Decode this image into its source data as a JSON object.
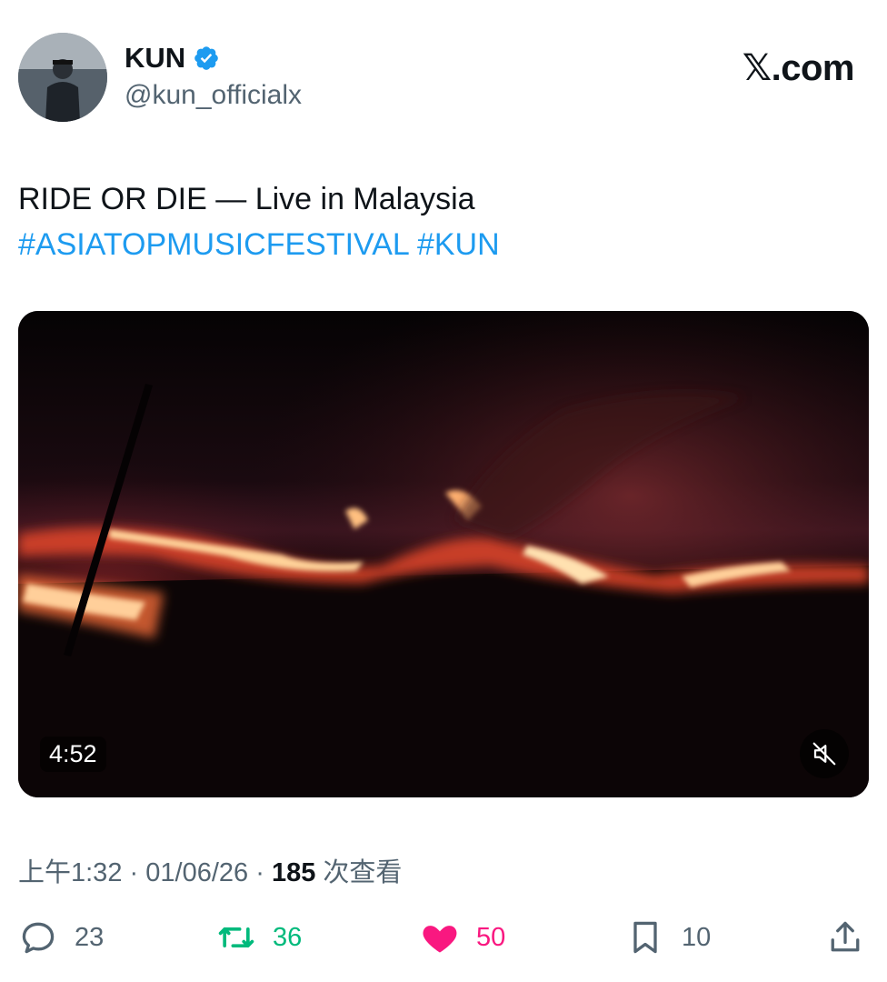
{
  "author": {
    "display_name": "KUN",
    "handle": "@kun_officialx",
    "verified": true,
    "avatar_icon": "profile-photo"
  },
  "brand": {
    "label": "𝕏.com"
  },
  "tweet": {
    "text_line": "RIDE OR DIE — Live in Malaysia",
    "hashtags": [
      "#ASIATOPMUSICFESTIVAL",
      "#KUN"
    ]
  },
  "media": {
    "duration": "4:52",
    "mute_icon": "muted-speaker-icon"
  },
  "meta": {
    "time": "上午1:32",
    "separator": "·",
    "date": "01/06/26",
    "views_count": "185",
    "views_label": "次查看"
  },
  "actions": {
    "replies": "23",
    "retweets": "36",
    "likes": "50",
    "bookmarks": "10"
  },
  "colors": {
    "hashtag": "#1d9bf0",
    "verified": "#1d9bf0",
    "retweet": "#00ba7c",
    "like": "#f91880",
    "secondary_text": "#536471"
  }
}
